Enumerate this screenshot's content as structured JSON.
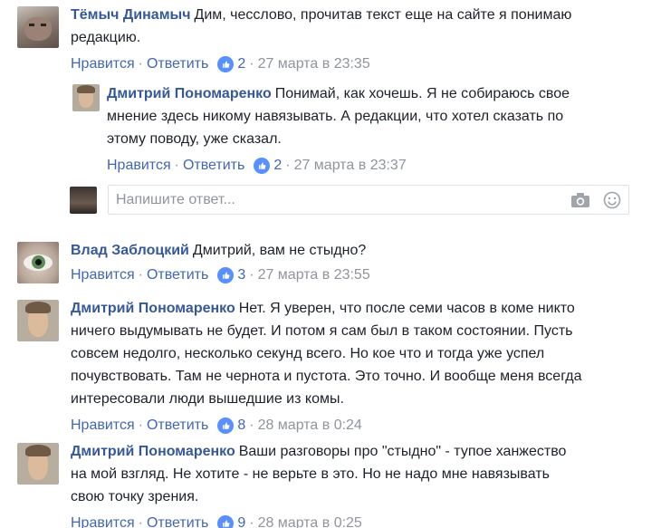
{
  "comments": [
    {
      "author": "Тёмыч Динамыч",
      "lines": [
        "Дим, чесслово, прочитав текст еще на сайте я понимаю",
        "редакцию."
      ],
      "like_label": "Нравится",
      "reply_label": "Ответить",
      "likes": "2",
      "time": "27 марта в 23:35"
    },
    {
      "author": "Дмитрий Пономаренко",
      "lines": [
        "Понимай, как хочешь. Я не собираюсь свое",
        "мнение здесь никому навязывать. А редакции, что хотел сказать по",
        "этому поводу, уже сказал."
      ],
      "like_label": "Нравится",
      "reply_label": "Ответить",
      "likes": "2",
      "time": "27 марта в 23:37"
    },
    {
      "author": "Влад Заблоцкий",
      "lines": [
        "Дмитрий, вам не стыдно?"
      ],
      "like_label": "Нравится",
      "reply_label": "Ответить",
      "likes": "3",
      "time": "27 марта в 23:55"
    },
    {
      "author": "Дмитрий Пономаренко",
      "lines": [
        "Нет. Я уверен, что после семи часов в коме никто",
        "ничего выдумывать не будет. И потом я сам был в таком состоянии. Пусть",
        "совсем недолго, несколько секунд всего. Но кое что и тогда уже успел",
        "почувствовать. Там не чернота и пустота. Это точно. И вообще меня всегда",
        "интересовали люди вышедшие из комы."
      ],
      "like_label": "Нравится",
      "reply_label": "Ответить",
      "likes": "8",
      "time": "28 марта в 0:24"
    },
    {
      "author": "Дмитрий Пономаренко",
      "lines": [
        "Ваши разговоры про \"стыдно\" - тупое ханжество",
        "на мой взгляд. Не хотите - не верьте в это. Но не надо мне навязывать",
        "свою точку зрения."
      ],
      "like_label": "Нравится",
      "reply_label": "Ответить",
      "likes": "9",
      "time": "28 марта в 0:25"
    }
  ],
  "reply_box": {
    "placeholder": "Напишите ответ...",
    "icons": [
      "camera-icon",
      "smiley-icon"
    ]
  },
  "colors": {
    "author": "#365899",
    "link": "#4267b2",
    "meta": "#90949c",
    "like_badge": "#5890ff"
  }
}
